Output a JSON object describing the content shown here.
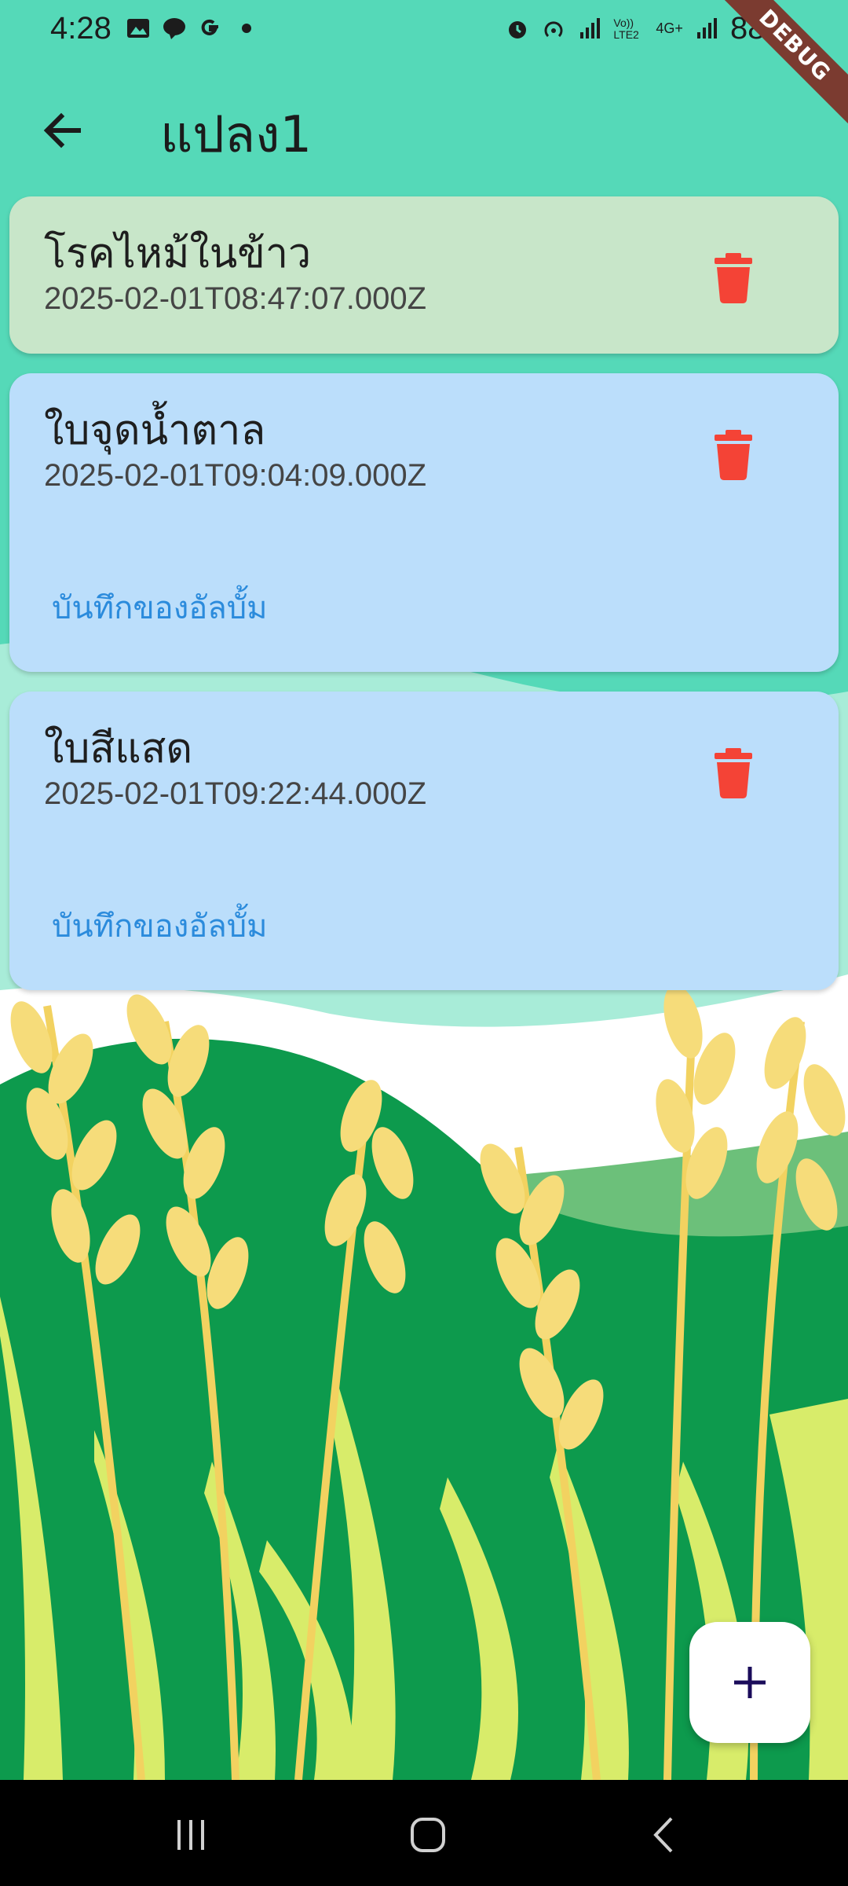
{
  "status_bar": {
    "time": "4:28",
    "battery": "88%",
    "network": "4G+",
    "volte": "Vo)) LTE2",
    "debug_banner": "DEBUG"
  },
  "app_bar": {
    "title": "แปลง1",
    "back_icon": "arrow-left-icon"
  },
  "cards": [
    {
      "title": "โรคไหม้ในข้าว",
      "date": "2025-02-01T08:47:07.000Z",
      "background": "#c8e6c9",
      "album_label": ""
    },
    {
      "title": "ใบจุดน้ำตาล",
      "date": "2025-02-01T09:04:09.000Z",
      "background": "#bbdefb",
      "album_label": "บันทึกของอัลบั้ม"
    },
    {
      "title": "ใบสีแสด",
      "date": "2025-02-01T09:22:44.000Z",
      "background": "#bbdefb",
      "album_label": "บันทึกของอัลบั้ม"
    }
  ],
  "fab": {
    "icon": "plus-icon"
  },
  "colors": {
    "delete": "#f44336",
    "accent_link": "#2b8bdc",
    "fab_icon": "#1a0b5a",
    "background_teal": "#55d9b8"
  },
  "nav_bar": {
    "recents_icon": "recents-icon",
    "home_icon": "home-icon",
    "back_icon": "back-chevron-icon"
  }
}
